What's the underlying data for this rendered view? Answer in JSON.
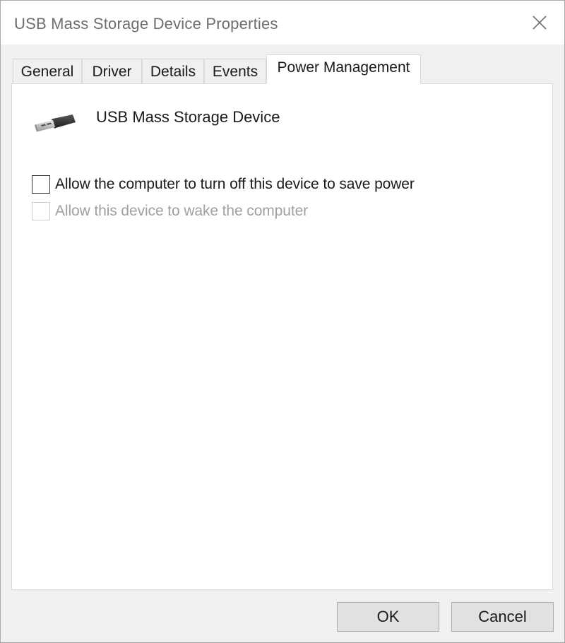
{
  "window": {
    "title": "USB Mass Storage Device Properties",
    "close_icon": "close-x-icon"
  },
  "tabs": [
    {
      "label": "General",
      "active": false
    },
    {
      "label": "Driver",
      "active": false
    },
    {
      "label": "Details",
      "active": false
    },
    {
      "label": "Events",
      "active": false
    },
    {
      "label": "Power Management",
      "active": true
    }
  ],
  "device": {
    "icon": "usb-connector-icon",
    "name": "USB Mass Storage Device"
  },
  "options": [
    {
      "label": "Allow the computer to turn off this device to save power",
      "checked": false,
      "enabled": true
    },
    {
      "label": "Allow this device to wake the computer",
      "checked": false,
      "enabled": false
    }
  ],
  "buttons": {
    "ok_label": "OK",
    "cancel_label": "Cancel"
  },
  "colors": {
    "window_bg": "#f0f0f0",
    "panel_bg": "#ffffff",
    "border": "#d9d9d9",
    "disabled_text": "#a0a0a0"
  }
}
